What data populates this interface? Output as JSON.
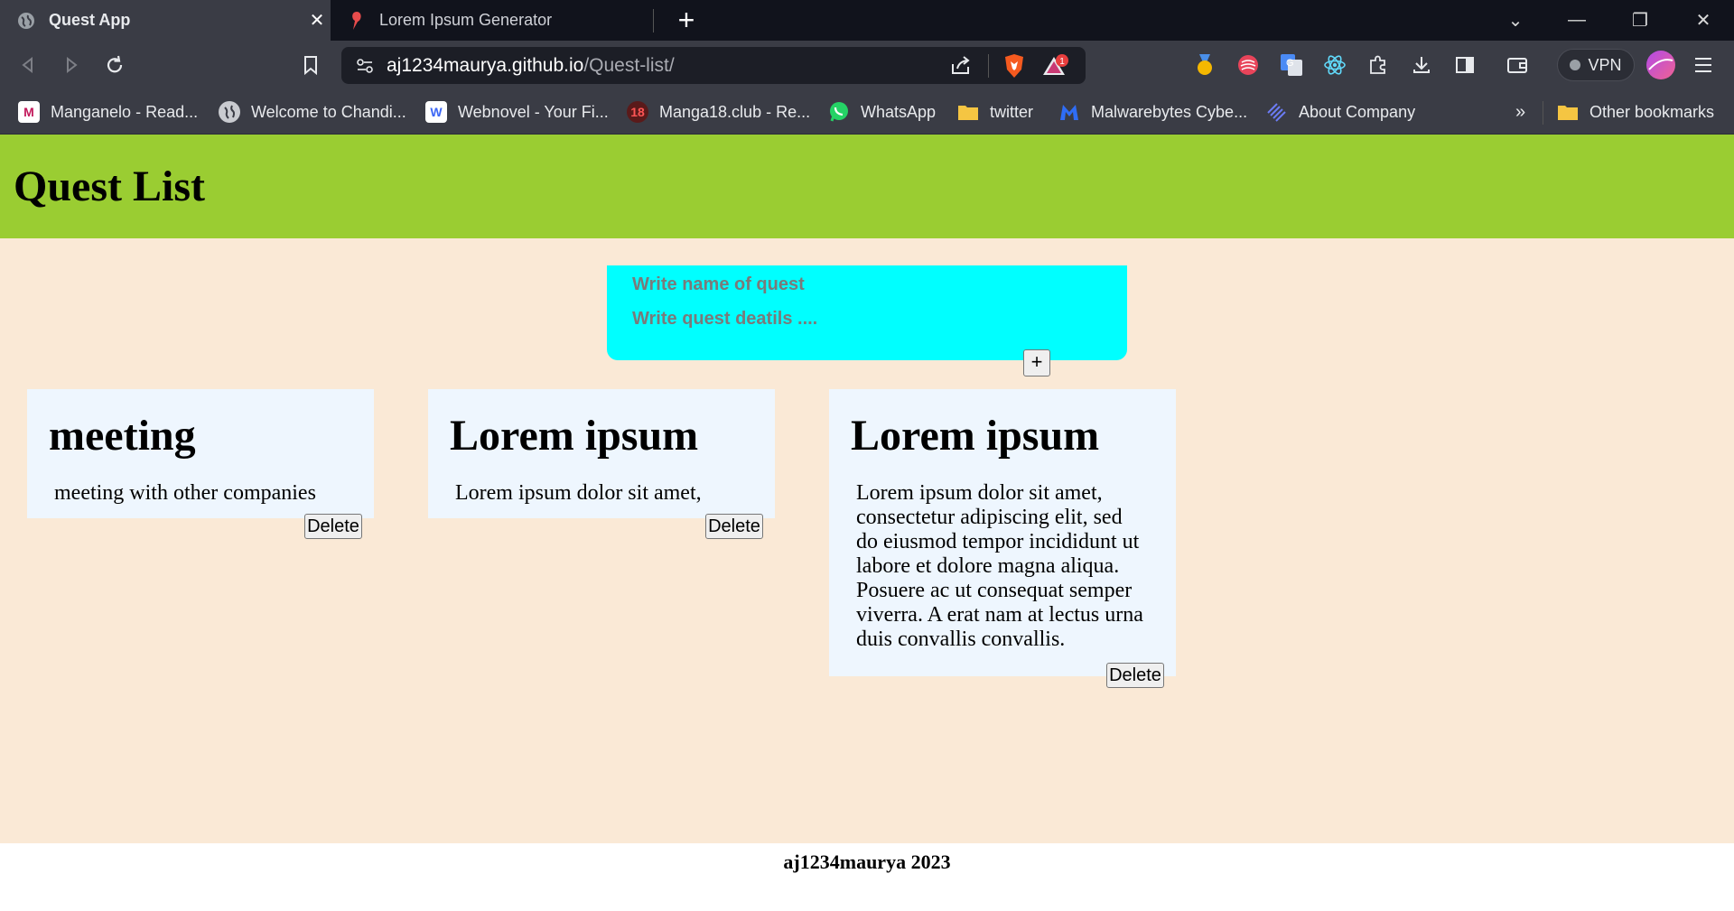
{
  "browser": {
    "tabs": [
      {
        "title": "Quest App",
        "active": true
      },
      {
        "title": "Lorem Ipsum Generator",
        "active": false
      }
    ],
    "address": {
      "host": "aj1234maurya.github.io",
      "path": "/Quest-list/"
    },
    "vpn_label": "VPN",
    "notification_count": "1",
    "bookmarks": [
      {
        "label": "Manganelo - Read...",
        "icon": "manganelo-icon"
      },
      {
        "label": "Welcome to Chandi...",
        "icon": "globe-icon"
      },
      {
        "label": "Webnovel - Your Fi...",
        "icon": "webnovel-icon"
      },
      {
        "label": "Manga18.club - Re...",
        "icon": "manga18-icon"
      },
      {
        "label": "WhatsApp",
        "icon": "whatsapp-icon"
      },
      {
        "label": "twitter",
        "icon": "folder-icon"
      },
      {
        "label": "Malwarebytes Cybe...",
        "icon": "malwarebytes-icon"
      },
      {
        "label": "About Company",
        "icon": "about-company-icon"
      }
    ],
    "other_bookmarks": "Other bookmarks",
    "overflow": "»"
  },
  "page": {
    "title": "Quest List",
    "form": {
      "name_placeholder": "Write name of quest",
      "details_placeholder": "Write quest deatils ....",
      "add_label": "+"
    },
    "quests": [
      {
        "title": "meeting",
        "details": "meeting with other companies",
        "delete_label": "Delete"
      },
      {
        "title": "Lorem ipsum",
        "details": "Lorem ipsum dolor sit amet,",
        "delete_label": "Delete"
      },
      {
        "title": "Lorem ipsum",
        "details": "Lorem ipsum dolor sit amet, consectetur adipiscing elit, sed do eiusmod tempor incididunt ut labore et dolore magna aliqua. Posuere ac ut consequat semper viverra. A erat nam at lectus urna duis convallis convallis.",
        "delete_label": "Delete"
      }
    ],
    "footer": "aj1234maurya 2023"
  },
  "colors": {
    "header": "#9acd32",
    "background": "#fae9d6",
    "form": "#00ffff",
    "card": "#eef6fe"
  }
}
